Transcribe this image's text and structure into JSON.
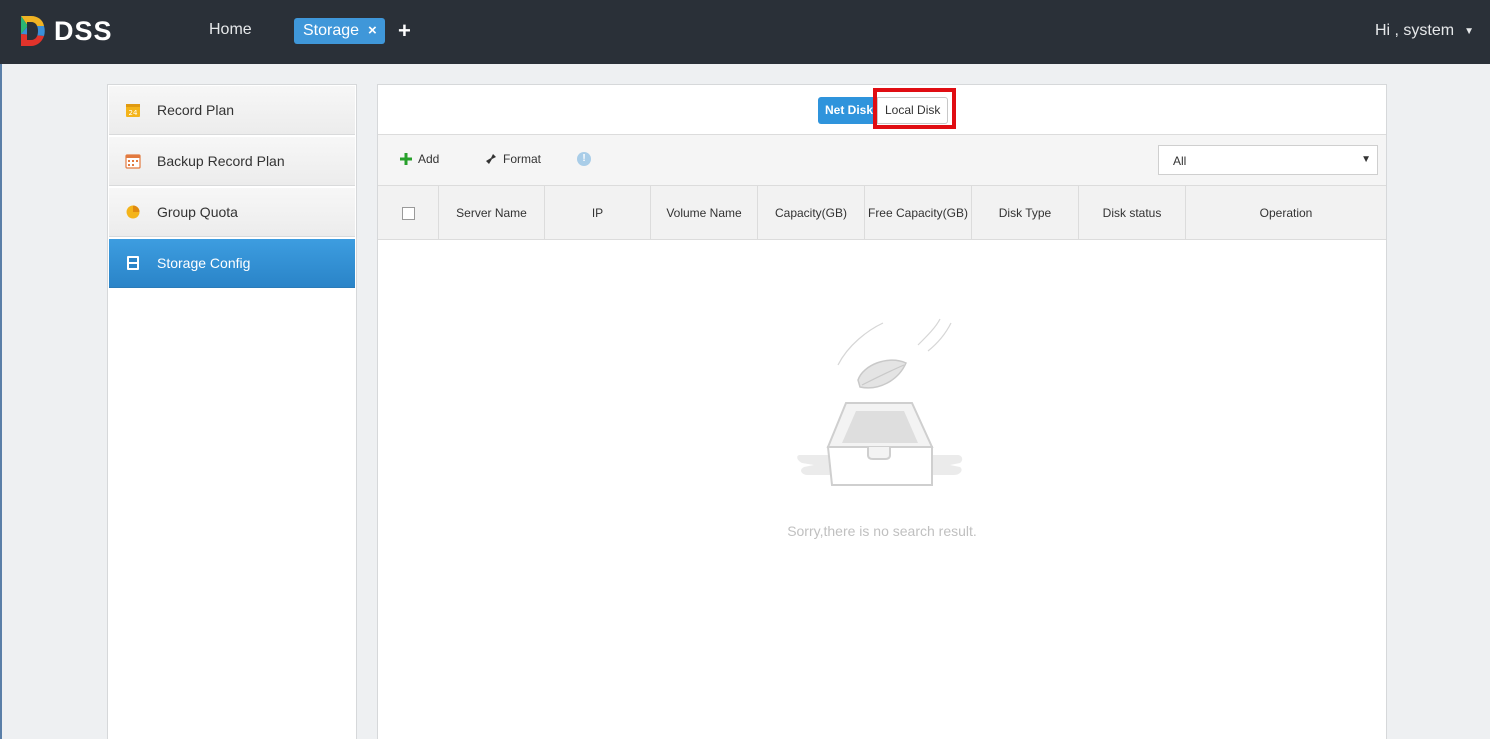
{
  "app": {
    "name": "DSS"
  },
  "nav": {
    "home_label": "Home",
    "active_tab_label": "Storage",
    "close_symbol": "×",
    "add_symbol": "+"
  },
  "user": {
    "greeting": "Hi , system",
    "caret": "▼"
  },
  "sidebar": {
    "items": [
      {
        "label": "Record Plan",
        "icon": "calendar-24-icon",
        "active": false
      },
      {
        "label": "Backup Record Plan",
        "icon": "calendar-grid-icon",
        "active": false
      },
      {
        "label": "Group Quota",
        "icon": "pie-chart-icon",
        "active": false
      },
      {
        "label": "Storage Config",
        "icon": "storage-disk-icon",
        "active": true
      }
    ]
  },
  "segment": {
    "net_disk": "Net Disk",
    "local_disk": "Local Disk",
    "selected": "Net Disk"
  },
  "toolbar": {
    "add_label": "Add",
    "format_label": "Format",
    "info_symbol": "!"
  },
  "filter": {
    "value": "All",
    "caret": "▼"
  },
  "table": {
    "columns": [
      "Server Name",
      "IP",
      "Volume Name",
      "Capacity(GB)",
      "Free Capacity(GB)",
      "Disk Type",
      "Disk status",
      "Operation"
    ],
    "rows": []
  },
  "empty_state": {
    "message": "Sorry,there is no search result."
  },
  "colors": {
    "topbar": "#2a3038",
    "accent": "#2f94dc",
    "highlight": "#e00d12"
  }
}
